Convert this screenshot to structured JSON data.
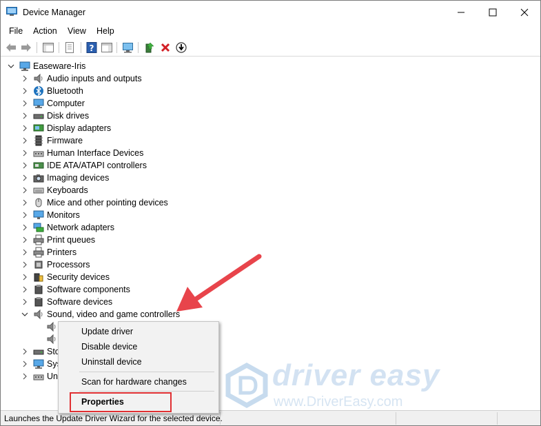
{
  "window": {
    "title": "Device Manager"
  },
  "menubar": {
    "items": [
      "File",
      "Action",
      "View",
      "Help"
    ]
  },
  "tree": {
    "root": "Easeware-Iris",
    "categories": [
      {
        "label": "Audio inputs and outputs",
        "icon": "speaker-icon"
      },
      {
        "label": "Bluetooth",
        "icon": "bluetooth-icon"
      },
      {
        "label": "Computer",
        "icon": "computer-icon"
      },
      {
        "label": "Disk drives",
        "icon": "disk-drive-icon"
      },
      {
        "label": "Display adapters",
        "icon": "display-adapter-icon"
      },
      {
        "label": "Firmware",
        "icon": "firmware-icon"
      },
      {
        "label": "Human Interface Devices",
        "icon": "hid-icon"
      },
      {
        "label": "IDE ATA/ATAPI controllers",
        "icon": "ide-controller-icon"
      },
      {
        "label": "Imaging devices",
        "icon": "camera-icon"
      },
      {
        "label": "Keyboards",
        "icon": "keyboard-icon"
      },
      {
        "label": "Mice and other pointing devices",
        "icon": "mouse-icon"
      },
      {
        "label": "Monitors",
        "icon": "monitor-icon"
      },
      {
        "label": "Network adapters",
        "icon": "network-icon"
      },
      {
        "label": "Print queues",
        "icon": "printer-icon"
      },
      {
        "label": "Printers",
        "icon": "printer-icon"
      },
      {
        "label": "Processors",
        "icon": "processor-icon"
      },
      {
        "label": "Security devices",
        "icon": "security-icon"
      },
      {
        "label": "Software components",
        "icon": "software-icon"
      },
      {
        "label": "Software devices",
        "icon": "software-icon"
      },
      {
        "label": "Sound, video and game controllers",
        "icon": "speaker-icon"
      }
    ],
    "truncated": [
      "Sto",
      "Sys",
      "Un"
    ]
  },
  "context_menu": {
    "items": [
      "Update driver",
      "Disable device",
      "Uninstall device",
      "Scan for hardware changes",
      "Properties"
    ],
    "highlight_color": "#e02f32"
  },
  "statusbar": {
    "text": "Launches the Update Driver Wizard for the selected device."
  },
  "watermark": {
    "brand": "driver easy",
    "url": "www.DriverEasy.com"
  },
  "colors": {
    "arrow": "#e8444b",
    "accent": "#1e73be"
  }
}
